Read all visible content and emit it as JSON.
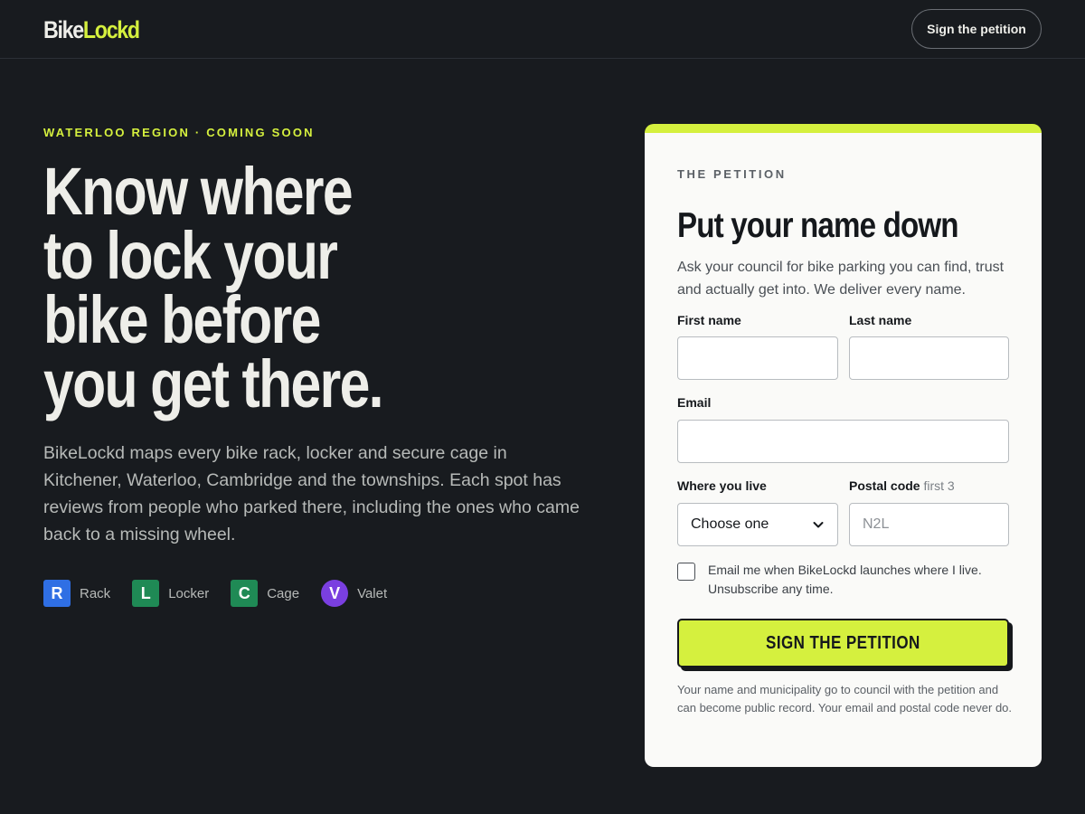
{
  "nav": {
    "logo_part1": "Bike",
    "logo_part2": "Lockd",
    "cta": "Sign the petition"
  },
  "hero": {
    "eyebrow": "WATERLOO REGION · COMING SOON",
    "headline_lines": [
      "Know where",
      "to lock your",
      "bike before",
      "you get there."
    ],
    "lede": "BikeLockd maps every bike rack, locker and secure cage in Kitchener, Waterloo, Cambridge and the townships. Each spot has reviews from people who parked there, including the ones who came back to a missing wheel.",
    "legend": [
      {
        "letter": "R",
        "label": "Rack",
        "color": "#2f6fe4"
      },
      {
        "letter": "L",
        "label": "Locker",
        "color": "#1f8a55"
      },
      {
        "letter": "C",
        "label": "Cage",
        "color": "#1f8a55"
      },
      {
        "letter": "V",
        "label": "Valet",
        "color": "#7a3fe0"
      }
    ]
  },
  "form": {
    "eyebrow": "THE PETITION",
    "title": "Put your name down",
    "description": "Ask your council for bike parking you can find, trust and actually get into. We deliver every name.",
    "first_name_label": "First name",
    "first_name_value": "",
    "last_name_label": "Last name",
    "last_name_value": "",
    "email_label": "Email",
    "email_value": "",
    "where_label": "Where you live",
    "where_value": "Choose one",
    "postal_label": "Postal code",
    "postal_hint": "first 3",
    "postal_placeholder": "N2L",
    "checkbox_label": "Email me when BikeLockd launches where I live. Unsubscribe any time.",
    "checkbox_checked": false,
    "submit": "SIGN THE PETITION",
    "fineprint": "Your name and municipality go to council with the petition and can become public record. Your email and postal code never do."
  },
  "colors": {
    "accent": "#d5f03e",
    "background": "#181b1f",
    "card": "#fafaf8"
  }
}
